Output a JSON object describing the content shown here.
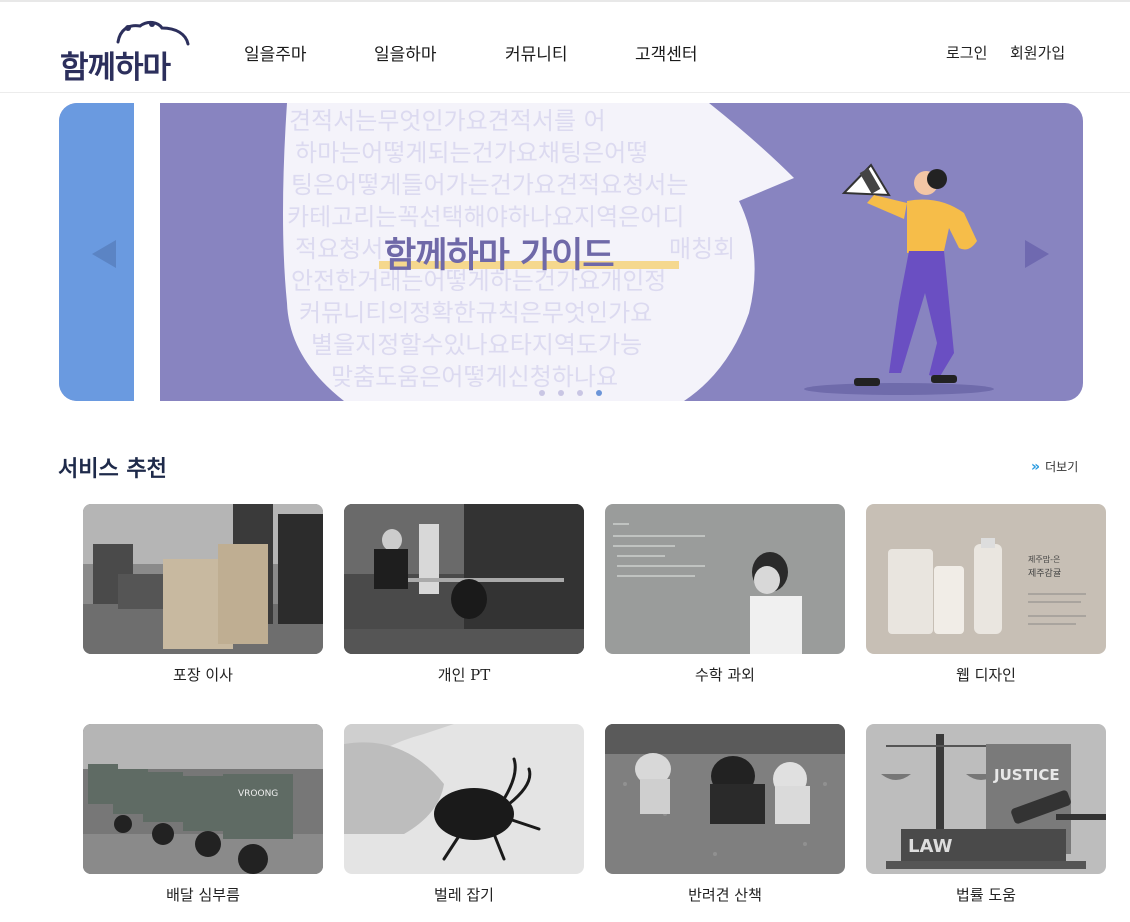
{
  "header": {
    "logo_text": "함께하마",
    "nav": [
      "일을주마",
      "일을하마",
      "커뮤니티",
      "고객센터"
    ],
    "login": "로그인",
    "signup": "회원가입"
  },
  "banner": {
    "title": "함께하마 가이드",
    "background_text": "견적서는무엇인가요견적서를 어 하마는어떻게되는건가요채팅은어떻 팅은어떻게들어가는건가요견적요청서는 카테고리는꼭선택해야하나요지역은어디 적요청서 매칭회 안전한거래는어떻게하는건가요개인정 커뮤니티의정확한규칙은무엇인가요 별을지정할수있나요타지역도가능 맞춤도움은어떻게신청하나요",
    "slide_count": 4,
    "active_slide": 4,
    "colors": {
      "main": "#8884c0",
      "left_panel": "#6a9ae0",
      "accent": "#f5d27a"
    }
  },
  "section": {
    "title": "서비스 추천",
    "more_label": "더보기",
    "more_icon": "double-chevron-right-icon"
  },
  "services": [
    {
      "label": "포장 이사",
      "image": "packing-move-photo"
    },
    {
      "label": "개인 PT",
      "image": "personal-training-photo"
    },
    {
      "label": "수학 과외",
      "image": "math-tutoring-photo"
    },
    {
      "label": "웹 디자인",
      "image": "web-design-photo"
    },
    {
      "label": "배달 심부름",
      "image": "delivery-scooters-photo"
    },
    {
      "label": "벌레 잡기",
      "image": "bug-catching-photo"
    },
    {
      "label": "반려견 산책",
      "image": "dog-walking-photo"
    },
    {
      "label": "법률 도움",
      "image": "legal-help-photo"
    }
  ],
  "image_text": {
    "packing": "",
    "design_product": "제주감귤",
    "design_title": "제주맘-은",
    "justice": "JUSTICE",
    "law": "LAW",
    "scooter_brand": "VROONG"
  }
}
